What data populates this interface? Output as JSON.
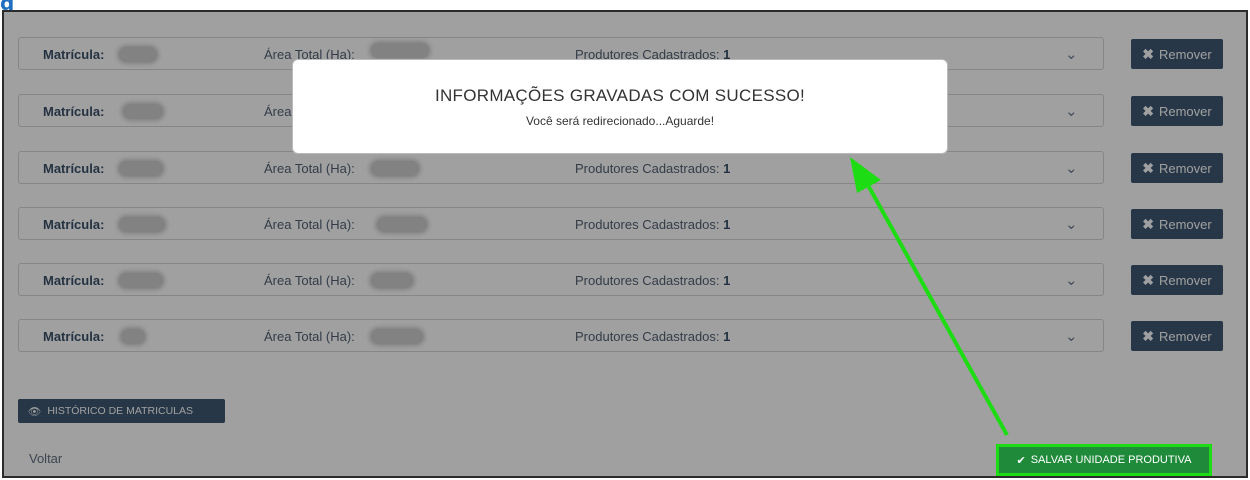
{
  "page": {
    "section_title": "g"
  },
  "rows": [
    {
      "matricula_label": "Matrícula:",
      "area_label": "Área Total (Ha):",
      "produtores_label": "Produtores Cadastrados:",
      "produtores_count": "1",
      "remove_label": "Remover"
    },
    {
      "matricula_label": "Matrícula:",
      "area_label": "Área",
      "produtores_label": "",
      "produtores_count": "",
      "remove_label": "Remover"
    },
    {
      "matricula_label": "Matrícula:",
      "area_label": "Área Total (Ha):",
      "produtores_label": "Produtores Cadastrados:",
      "produtores_count": "1",
      "remove_label": "Remover"
    },
    {
      "matricula_label": "Matrícula:",
      "area_label": "Área Total (Ha):",
      "produtores_label": "Produtores Cadastrados:",
      "produtores_count": "1",
      "remove_label": "Remover"
    },
    {
      "matricula_label": "Matrícula:",
      "area_label": "Área Total (Ha):",
      "produtores_label": "Produtores Cadastrados:",
      "produtores_count": "1",
      "remove_label": "Remover"
    },
    {
      "matricula_label": "Matrícula:",
      "area_label": "Área Total (Ha):",
      "produtores_label": "Produtores Cadastrados:",
      "produtores_count": "1",
      "remove_label": "Remover"
    }
  ],
  "actions": {
    "historico_label": "HISTÓRICO DE MATRICULAS",
    "voltar_label": "Voltar",
    "salvar_label": "SALVAR UNIDADE PRODUTIVA"
  },
  "modal": {
    "title": "INFORMAÇÕES GRAVADAS COM SUCESSO!",
    "message": "Você será redirecionado...Aguarde!"
  },
  "colors": {
    "primary": "#23415f",
    "success": "#1f8a3a",
    "highlight": "#1edc14",
    "title_blue": "#1f6ec0"
  },
  "icons": {
    "remove": "times-icon",
    "expand": "chevron-down-icon",
    "history": "eye-icon",
    "save": "check-icon"
  }
}
